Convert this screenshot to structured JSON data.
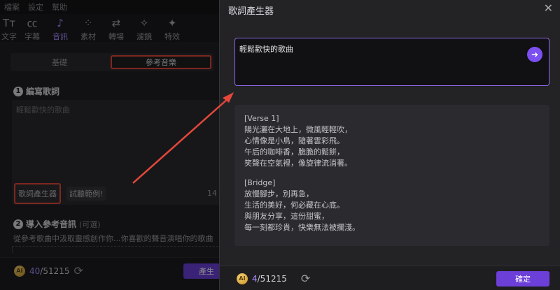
{
  "menu": [
    "檔案",
    "設定",
    "幫助"
  ],
  "toolbar": [
    {
      "label": "文字",
      "icon": "text-icon",
      "glyph": "Tт"
    },
    {
      "label": "字幕",
      "icon": "subtitle-icon",
      "glyph": "㏄"
    },
    {
      "label": "音訊",
      "icon": "music-note-icon",
      "glyph": "♪",
      "active": true
    },
    {
      "label": "素材",
      "icon": "grid-icon",
      "glyph": "⁘"
    },
    {
      "label": "轉場",
      "icon": "transition-icon",
      "glyph": "⇄"
    },
    {
      "label": "濾鏡",
      "icon": "sparkle-icon",
      "glyph": "✧"
    },
    {
      "label": "特效",
      "icon": "effect-icon",
      "glyph": "✦"
    }
  ],
  "tabs": [
    "基礎",
    "參考音樂"
  ],
  "section1": {
    "num": "1",
    "title": "編寫歌詞",
    "placeholder": "輕鬆歡快的歌曲"
  },
  "buttons": {
    "lyric_gen": "歌詞產生器",
    "listen": "試聽範例!"
  },
  "left_count": "14",
  "section2": {
    "num": "2",
    "title": "導入參考音訊",
    "optional": "(可選)",
    "desc": "從參考歌曲中汲取靈感創作你...你喜歡的聲音演唱你的歌曲"
  },
  "left_footer": {
    "used": "40",
    "total": "/51215",
    "generate": "產生"
  },
  "dialog": {
    "title": "歌詞產生器",
    "prompt": "輕鬆歡快的歌曲",
    "lyrics": [
      "[Verse 1]",
      "陽光灑在大地上，微風輕輕吹，",
      "心情像是小鳥，隨著雲彩飛。",
      "午后的咖啡香，脆脆的鬆餅，",
      "笑聲在空氣裡，像旋律流淌著。",
      "",
      "[Bridge]",
      "放慢腳步，別再急，",
      "生活的美好，何必藏在心底。",
      "與朋友分享，這份甜蜜，",
      "每一刻都珍貴，快樂無法被攔淺。"
    ],
    "credits_used": "4",
    "credits_total": "/51215",
    "confirm": "確定"
  },
  "coin_label": "AI",
  "colors": {
    "accent": "#7b4ff0",
    "highlight": "#e5473a",
    "panel": "#232326"
  }
}
